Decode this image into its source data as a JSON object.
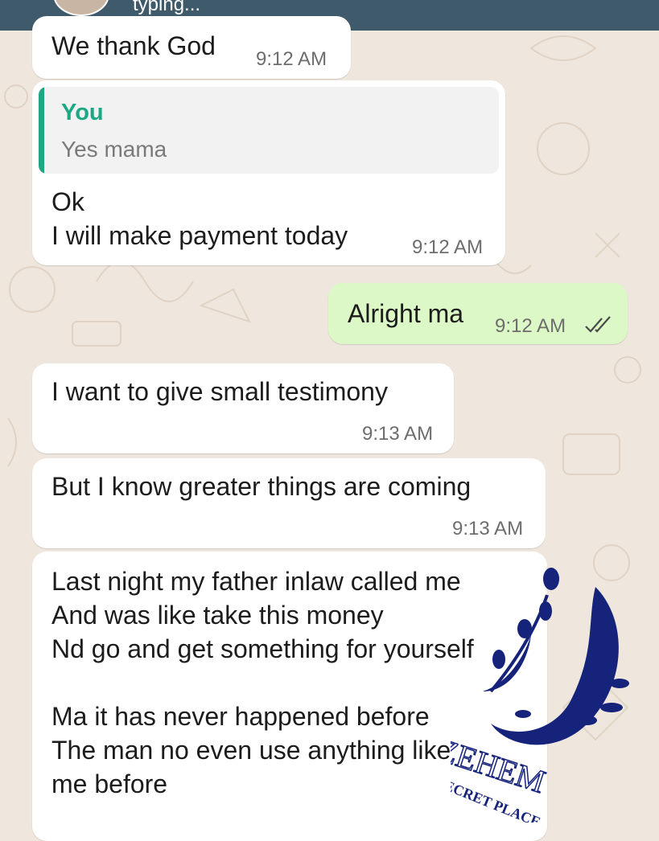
{
  "header": {
    "status": "typing..."
  },
  "messages": [
    {
      "direction": "incoming",
      "text": "We thank God",
      "time": "9:12 AM"
    },
    {
      "direction": "incoming",
      "quote": {
        "author": "You",
        "text": "Yes mama"
      },
      "text": "Ok\nI will make payment today",
      "time": "9:12 AM"
    },
    {
      "direction": "outgoing",
      "text": "Alright ma",
      "time": "9:12 AM",
      "status": "read"
    },
    {
      "direction": "incoming",
      "text": "I want to give small testimony",
      "time": "9:13 AM"
    },
    {
      "direction": "incoming",
      "text": "But I know greater things are coming",
      "time": "9:13 AM"
    },
    {
      "direction": "incoming",
      "text": "Last night my father inlaw called me\nAnd was like take this money\nNd go and get something for yourself\n\nMa it has never happened before\nThe man no even use anything like\nme before",
      "time": ""
    }
  ],
  "watermark": {
    "line1": "ZEHEM",
    "line2": "SECRET PLACE"
  },
  "colors": {
    "header_bg": "#3f5a6a",
    "chat_bg": "#efe7dd",
    "incoming_bubble": "#ffffff",
    "outgoing_bubble": "#dcf8c6",
    "quote_accent": "#1da884",
    "read_tick": "#4a4a4a",
    "watermark": "#16237a"
  }
}
